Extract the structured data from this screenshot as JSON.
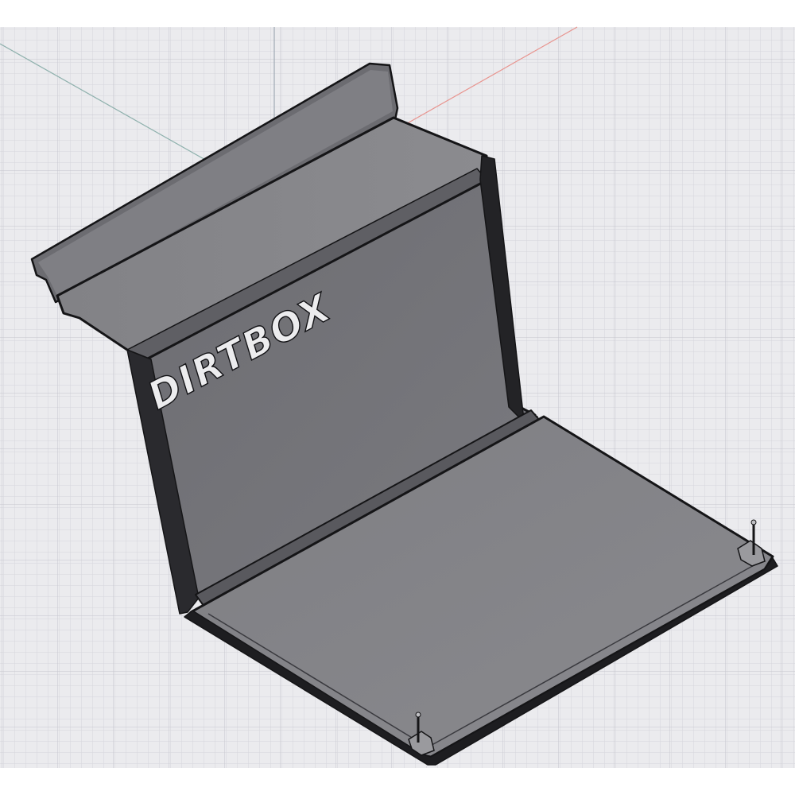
{
  "model": {
    "logo_text": "DIRTBOX"
  },
  "colors": {
    "background": "#ffffff",
    "canvas": "#ebebee",
    "grid_minor": "#d6d6dc",
    "grid_major": "#c5c5cd",
    "axis_x": "#e8948f",
    "axis_y": "#8fb1ad",
    "axis_z": "#9fa9b4",
    "edge": "#151517",
    "face_top": "#858589",
    "face_back": "#727277",
    "face_bottom": "#838387",
    "face_lip": "#6c6c71",
    "logo_fill": "#ececee"
  }
}
